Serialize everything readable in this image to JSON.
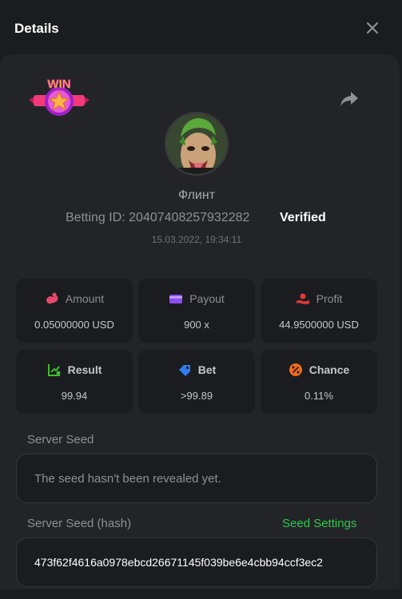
{
  "header": {
    "title": "Details"
  },
  "icons": {
    "close": "close-icon",
    "share": "share-icon",
    "badge": "win-badge-icon"
  },
  "badge": {
    "text": "WIN"
  },
  "player": {
    "name": "Флинт",
    "betting_id": "Betting ID: 20407408257932282",
    "verified_label": "Verified",
    "timestamp": "15.03.2022, 19:34:11"
  },
  "stats": {
    "amount": {
      "label": "Amount",
      "value": "0.05000000 USD",
      "color": "#e8476b"
    },
    "payout": {
      "label": "Payout",
      "value": "900 x",
      "color": "#8b4cf0"
    },
    "profit": {
      "label": "Profit",
      "value": "44.9500000 USD",
      "color": "#e03a3a"
    },
    "result": {
      "label": "Result",
      "value": "99.94",
      "color": "#3ebd2e"
    },
    "bet": {
      "label": "Bet",
      "value": ">99.89",
      "color": "#2f7df0"
    },
    "chance": {
      "label": "Chance",
      "value": "0.11%",
      "color": "#f26a1b"
    }
  },
  "server_seed": {
    "label": "Server Seed",
    "value": "The seed hasn't been revealed yet."
  },
  "server_seed_hash": {
    "label": "Server Seed (hash)",
    "settings_link": "Seed Settings",
    "value": "473f62f4616a0978ebcd26671145f039be6e4cbb94ccf3ec2"
  },
  "colors": {
    "accent_green": "#2ec84a",
    "panel": "#232428",
    "card": "#1b1c20"
  }
}
